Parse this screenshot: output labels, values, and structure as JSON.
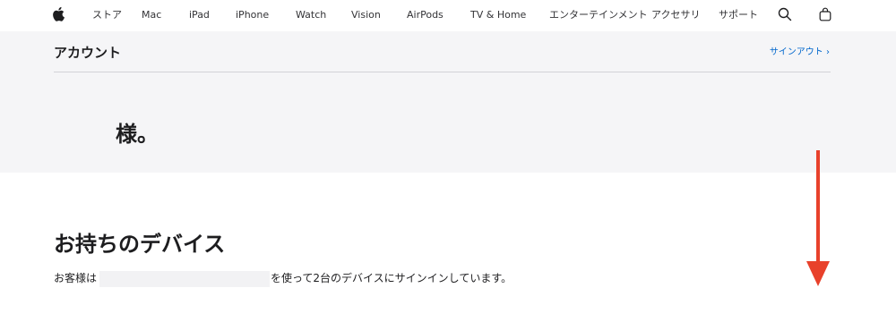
{
  "nav": {
    "items": [
      {
        "label": "ストア"
      },
      {
        "label": "Mac"
      },
      {
        "label": "iPad"
      },
      {
        "label": "iPhone"
      },
      {
        "label": "Watch"
      },
      {
        "label": "Vision"
      },
      {
        "label": "AirPods"
      },
      {
        "label": "TV & Home"
      },
      {
        "label": "エンターテインメント"
      },
      {
        "label": "アクセサリ"
      },
      {
        "label": "サポート"
      }
    ],
    "icons": [
      "apple-logo-icon",
      "search-icon",
      "bag-icon"
    ]
  },
  "account": {
    "title": "アカウント",
    "signout_label": "サインアウト ›",
    "greeting": "様。"
  },
  "devices": {
    "title": "お持ちのデバイス",
    "description_prefix": "お客様は",
    "description_suffix": "を使って2台のデバイスにサインインしています。"
  },
  "colors": {
    "link": "#0066cc",
    "band_background": "#f5f5f7",
    "annotation_arrow": "#e8412b"
  }
}
